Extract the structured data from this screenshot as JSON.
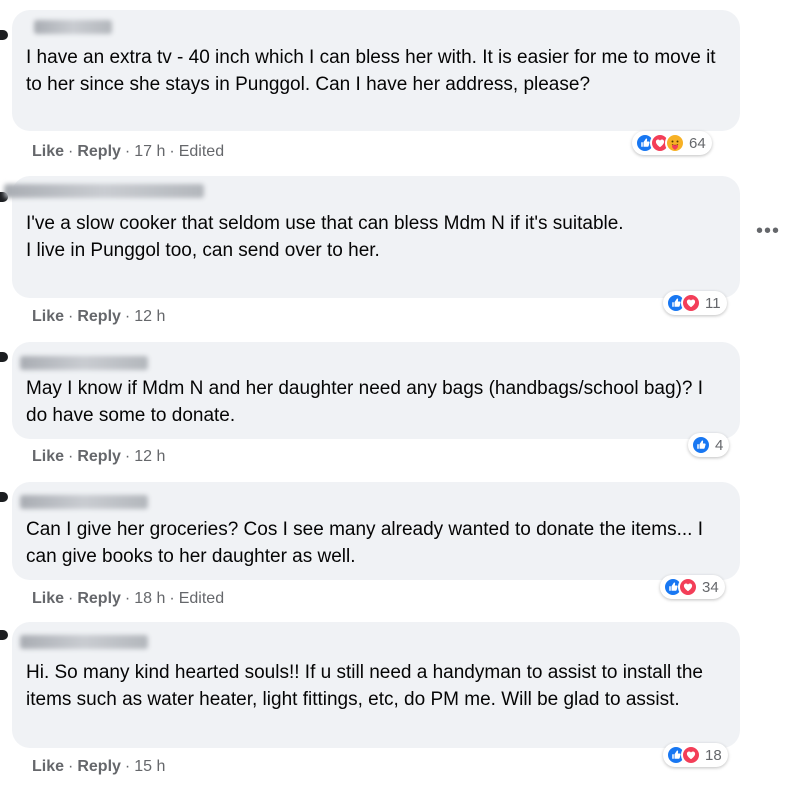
{
  "comments": [
    {
      "text": "I have an extra tv - 40 inch which I can bless her with. It is easier for me to move it to her since she stays in Punggol. Can I have her address, please?",
      "like_label": "Like",
      "reply_label": "Reply",
      "time": "17 h",
      "edited": "Edited",
      "reaction_count": "64",
      "reactions": [
        "like-icon",
        "love-icon",
        "care-icon"
      ]
    },
    {
      "text": "I've a slow cooker that seldom use that can bless Mdm N if it's suitable.\nI live in Punggol too, can send over to her.",
      "like_label": "Like",
      "reply_label": "Reply",
      "time": "12 h",
      "reaction_count": "11",
      "reactions": [
        "like-icon",
        "love-icon"
      ]
    },
    {
      "text": "May I know if Mdm N and her daughter need any bags (handbags/school bag)? I do have some to donate.",
      "like_label": "Like",
      "reply_label": "Reply",
      "time": "12 h",
      "reaction_count": "4",
      "reactions": [
        "like-icon"
      ]
    },
    {
      "text": "Can I give her groceries? Cos I see many already wanted to donate the items... I can give books to her daughter as well.",
      "like_label": "Like",
      "reply_label": "Reply",
      "time": "18 h",
      "edited": "Edited",
      "reaction_count": "34",
      "reactions": [
        "like-icon",
        "love-icon"
      ]
    },
    {
      "text": "Hi. So many kind hearted souls!! If u still need a handyman to assist to install the items such as water heater, light fittings, etc, do PM me. Will be glad to assist.",
      "like_label": "Like",
      "reply_label": "Reply",
      "time": "15 h",
      "reaction_count": "18",
      "reactions": [
        "like-icon",
        "love-icon"
      ]
    }
  ],
  "more_icon": "more-options-icon",
  "colors": {
    "bubble": "#f0f2f5",
    "meta_text": "#65676b",
    "like": "#1877f2",
    "love": "#f33e58",
    "care": "#f7b125"
  }
}
